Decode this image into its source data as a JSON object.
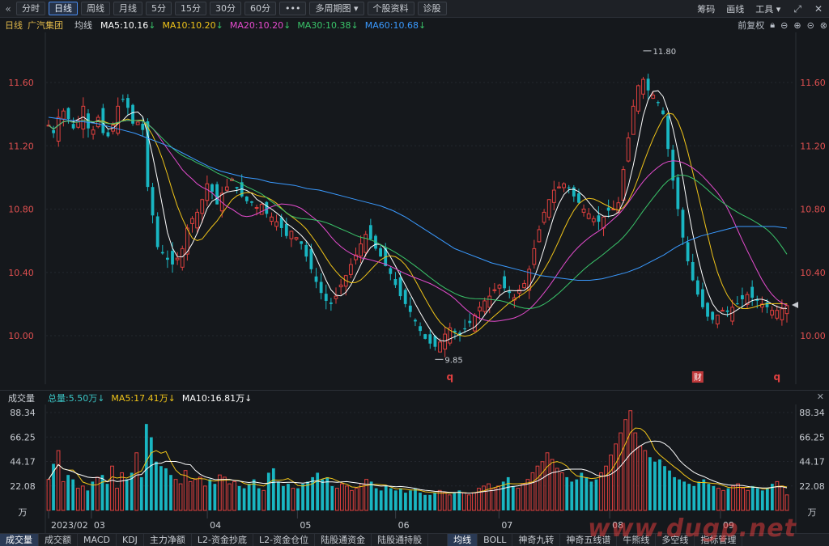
{
  "toolbar": {
    "collapse_icon": "collapse-left-icon",
    "buttons": [
      "分时",
      "日线",
      "周线",
      "月线",
      "5分",
      "15分",
      "30分",
      "60分",
      "•••",
      "多周期图 ▾",
      "个股资料",
      "诊股"
    ],
    "active": "日线",
    "right": [
      "筹码",
      "画线",
      "工具 ▾"
    ],
    "right_icons": [
      "expand-icon",
      "close-icon"
    ]
  },
  "header": {
    "period": "日线",
    "stock_name": "广汽集团",
    "ma_label": "均线",
    "ma_items": [
      {
        "text": "MA5:10.16",
        "color": "#ffffff"
      },
      {
        "text": "MA10:10.20",
        "color": "#f0c419"
      },
      {
        "text": "MA20:10.20",
        "color": "#e64ccf"
      },
      {
        "text": "MA30:10.38",
        "color": "#3ac56a"
      },
      {
        "text": "MA60:10.68",
        "color": "#3a9aff"
      }
    ],
    "arrow": "↓",
    "right_label": "前复权",
    "right_icons": [
      "lock-icon",
      "zoom-out-icon",
      "zoom-in-icon",
      "minus-icon",
      "close-icon"
    ]
  },
  "volume_header": {
    "title": "成交量",
    "items": [
      {
        "text": "总量:5.50万↓",
        "color": "#3ac5c5"
      },
      {
        "text": "MA5:17.41万↓",
        "color": "#f0c419"
      },
      {
        "text": "MA10:16.81万↓",
        "color": "#ffffff"
      }
    ],
    "close": "✕"
  },
  "tabs": {
    "left": [
      "成交量",
      "成交额",
      "MACD",
      "KDJ",
      "主力净额",
      "L2-资金抄底",
      "L2-资金仓位",
      "陆股通资金",
      "陆股通持股"
    ],
    "right": [
      "均线",
      "BOLL",
      "神奇九转",
      "神奇五线谱",
      "牛熊线",
      "多空线",
      "指标管理"
    ],
    "active_left": "成交量",
    "active_right": "均线"
  },
  "watermark": "www.dugp.net",
  "chart_data": [
    {
      "type": "candlestick",
      "ylim": [
        9.7,
        11.85
      ],
      "yticks": [
        "11.60",
        "11.20",
        "10.80",
        "10.40",
        "10.00"
      ],
      "xtick_labels": [
        "2023/02",
        "03",
        "04",
        "05",
        "06",
        "07",
        "08",
        "09"
      ],
      "high_label": "11.80",
      "low_label": "9.85",
      "markers": [
        "q",
        "财",
        "q"
      ],
      "close_series": [
        11.33,
        11.28,
        11.38,
        11.42,
        11.37,
        11.31,
        11.36,
        11.45,
        11.31,
        11.3,
        11.38,
        11.28,
        11.26,
        11.33,
        11.45,
        11.49,
        11.44,
        11.34,
        11.35,
        11.3,
        10.94,
        10.76,
        10.56,
        10.52,
        10.48,
        10.45,
        10.49,
        10.55,
        10.68,
        10.74,
        10.78,
        10.86,
        10.96,
        10.91,
        10.83,
        10.9,
        10.94,
        10.99,
        10.93,
        10.88,
        10.85,
        10.84,
        10.81,
        10.83,
        10.77,
        10.75,
        10.72,
        10.68,
        10.63,
        10.66,
        10.62,
        10.58,
        10.5,
        10.42,
        10.34,
        10.27,
        10.22,
        10.2,
        10.25,
        10.32,
        10.38,
        10.45,
        10.51,
        10.58,
        10.64,
        10.61,
        10.55,
        10.5,
        10.44,
        10.39,
        10.32,
        10.25,
        10.2,
        10.15,
        10.09,
        10.03,
        9.98,
        9.95,
        9.93,
        9.96,
        10.01,
        10.05,
        10.02,
        10.0,
        10.04,
        10.08,
        10.13,
        10.18,
        10.22,
        10.25,
        10.29,
        10.32,
        10.3,
        10.27,
        10.24,
        10.29,
        10.33,
        10.42,
        10.55,
        10.67,
        10.78,
        10.86,
        10.92,
        10.94,
        10.96,
        10.93,
        10.88,
        10.84,
        10.8,
        10.77,
        10.74,
        10.72,
        10.75,
        10.79,
        10.8,
        10.84,
        11.05,
        11.25,
        11.45,
        11.58,
        11.62,
        11.55,
        11.52,
        11.47,
        11.4,
        11.18,
        10.98,
        10.8,
        10.62,
        10.47,
        10.35,
        10.26,
        10.18,
        10.12,
        10.1,
        10.13,
        10.16,
        10.15,
        10.18,
        10.2,
        10.23,
        10.26,
        10.24,
        10.22,
        10.2,
        10.18,
        10.16,
        10.16,
        10.17,
        10.19
      ],
      "ma60": [
        11.38,
        11.37,
        11.36,
        11.35,
        11.34,
        11.32,
        11.3,
        11.28,
        11.25,
        11.22,
        11.19,
        11.15,
        11.11,
        11.07,
        11.04,
        11.02,
        11.0,
        10.99,
        10.97,
        10.96,
        10.95,
        10.93,
        10.92,
        10.9,
        10.88,
        10.86,
        10.84,
        10.82,
        10.79,
        10.75,
        10.7,
        10.65,
        10.6,
        10.55,
        10.52,
        10.49,
        10.46,
        10.44,
        10.42,
        10.4,
        10.38,
        10.37,
        10.36,
        10.35,
        10.35,
        10.36,
        10.38,
        10.4,
        10.43,
        10.47,
        10.51,
        10.56,
        10.6,
        10.63,
        10.65,
        10.67,
        10.69,
        10.69,
        10.69,
        10.69,
        10.68
      ]
    },
    {
      "type": "bar",
      "ylim": [
        0,
        92
      ],
      "yticks": [
        "88.34",
        "66.25",
        "44.17",
        "22.08",
        "万"
      ],
      "unit": "万",
      "values": [
        28,
        42,
        54,
        26,
        32,
        28,
        20,
        22,
        18,
        26,
        30,
        32,
        24,
        40,
        20,
        34,
        28,
        34,
        52,
        30,
        78,
        66,
        44,
        40,
        38,
        32,
        28,
        24,
        36,
        26,
        28,
        30,
        22,
        28,
        24,
        32,
        30,
        24,
        26,
        22,
        20,
        24,
        28,
        20,
        18,
        34,
        38,
        26,
        22,
        24,
        20,
        20,
        24,
        26,
        30,
        34,
        28,
        30,
        22,
        20,
        24,
        22,
        18,
        20,
        24,
        28,
        26,
        20,
        18,
        22,
        20,
        18,
        20,
        16,
        18,
        20,
        16,
        14,
        14,
        16,
        18,
        16,
        14,
        16,
        18,
        16,
        14,
        16,
        20,
        22,
        24,
        20,
        22,
        26,
        30,
        22,
        20,
        24,
        28,
        34,
        40,
        44,
        52,
        46,
        38,
        34,
        30,
        26,
        28,
        34,
        30,
        26,
        28,
        34,
        40,
        50,
        60,
        70,
        82,
        90,
        70,
        58,
        54,
        48,
        44,
        46,
        40,
        36,
        30,
        28,
        26,
        24,
        22,
        26,
        28,
        24,
        22,
        20,
        18,
        20,
        22,
        24,
        20,
        18,
        22,
        20,
        18,
        20,
        24,
        26,
        22,
        14
      ]
    }
  ]
}
